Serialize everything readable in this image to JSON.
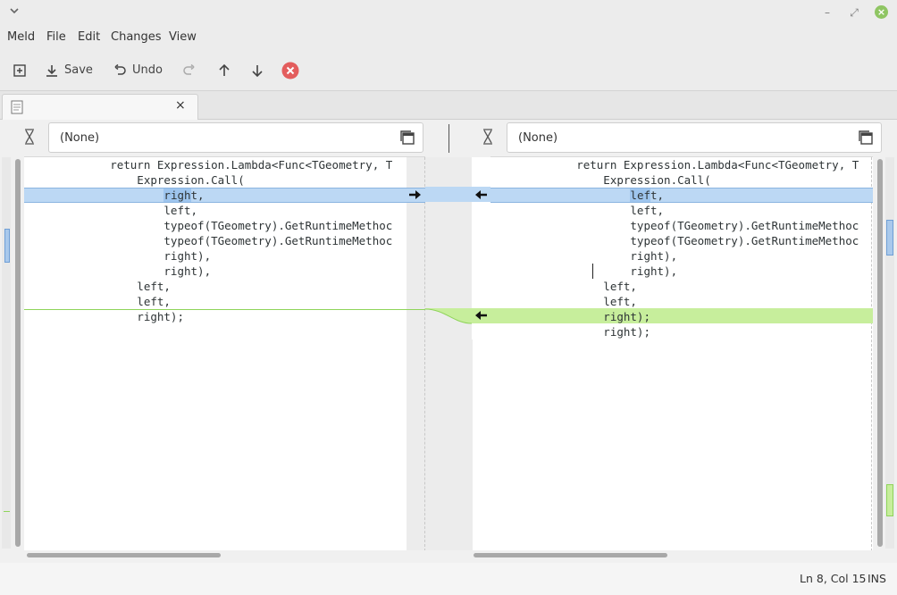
{
  "window": {
    "menu_icon": "chevron-down-icon",
    "controls": {
      "minimize": "–",
      "restore": "⤢",
      "close": "×"
    }
  },
  "menubar": {
    "items": [
      "Meld",
      "File",
      "Edit",
      "Changes",
      "View"
    ]
  },
  "toolbar": {
    "save_label": "Save",
    "undo_label": "Undo"
  },
  "tab": {
    "title": "",
    "close": "×"
  },
  "files": {
    "left_label": "(None)",
    "right_label": "(None)"
  },
  "left_lines": [
    "        return Expression.Lambda<Func<TGeometry, T",
    "            Expression.Call(",
    "                right,",
    "                left,",
    "                typeof(TGeometry).GetRuntimeMethoc",
    "                typeof(TGeometry).GetRuntimeMethoc",
    "                right),",
    "                right),",
    "            left,",
    "            left,",
    "            right);"
  ],
  "right_lines": [
    "        return Expression.Lambda<Func<TGeometry, T",
    "            Expression.Call(",
    "                left,",
    "                left,",
    "                typeof(TGeometry).GetRuntimeMethoc",
    "                typeof(TGeometry).GetRuntimeMethoc",
    "                right),",
    "                right),",
    "            left,",
    "            left,",
    "            right);",
    "            right);"
  ],
  "colors": {
    "changed": "#bcd8f4",
    "inserted": "#c7ee9c",
    "close_button": "#8fc563",
    "stop_button": "#e35d5d"
  },
  "status": {
    "position": "Ln 8, Col 15",
    "mode": "INS"
  }
}
